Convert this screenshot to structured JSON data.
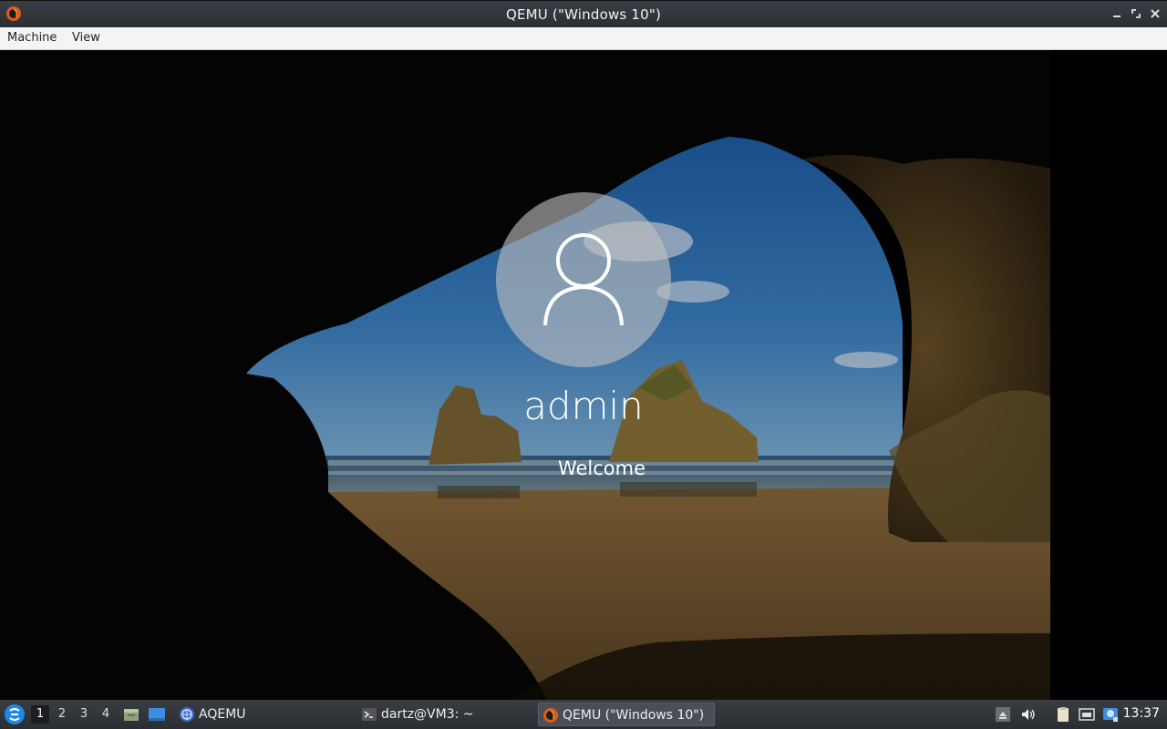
{
  "window": {
    "title": "QEMU (\"Windows 10\")"
  },
  "menubar": {
    "items": [
      {
        "label": "Machine"
      },
      {
        "label": "View"
      }
    ]
  },
  "login": {
    "username": "admin",
    "status": "Welcome"
  },
  "taskbar": {
    "workspaces": [
      "1",
      "2",
      "3",
      "4"
    ],
    "active_workspace": "1",
    "launchers": [
      {
        "icon": "file-manager-icon"
      },
      {
        "icon": "show-desktop-icon"
      }
    ],
    "tasks": [
      {
        "label": "AQEMU",
        "icon": "aqemu-icon"
      },
      {
        "label": "dartz@VM3: ~",
        "icon": "terminal-icon"
      },
      {
        "label": "QEMU (\"Windows 10\")",
        "icon": "qemu-icon",
        "active": true
      }
    ],
    "tray": [
      {
        "icon": "tray-expand-icon"
      },
      {
        "icon": "volume-icon"
      },
      {
        "icon": "clipboard-icon"
      },
      {
        "icon": "network-icon"
      },
      {
        "icon": "updates-icon"
      }
    ],
    "clock": "13:37"
  },
  "colors": {
    "titlebar": "#2f3338",
    "menubar": "#f4f4f4",
    "taskbar": "#2f3236",
    "accent": "#1e88e5"
  }
}
